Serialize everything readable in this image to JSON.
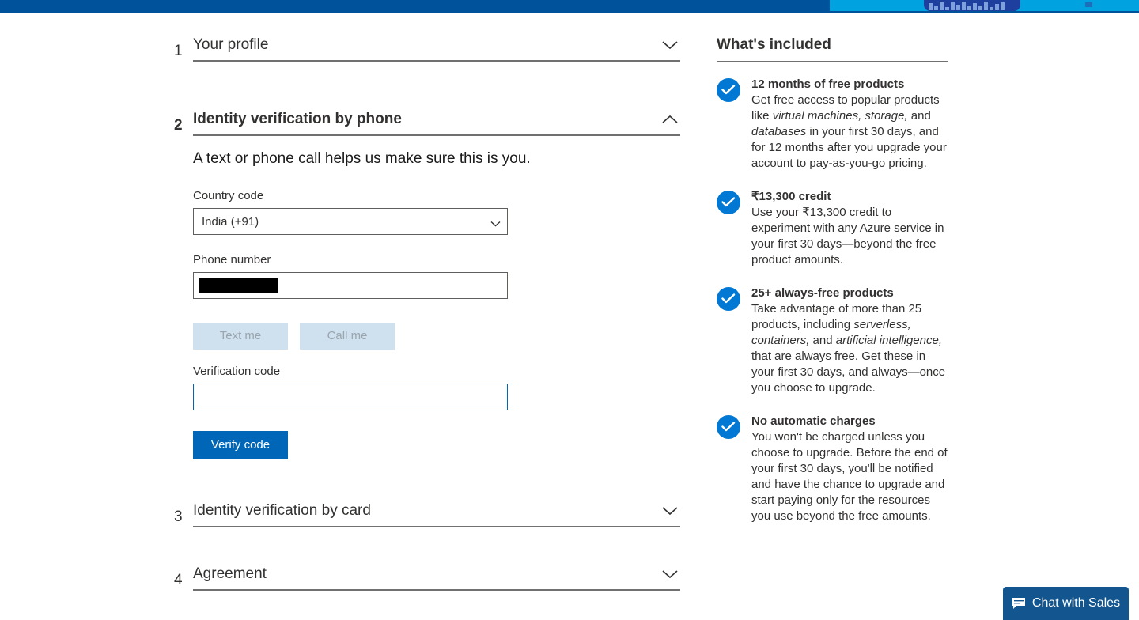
{
  "chrome": {
    "strip_color": "#00529b",
    "strip_accent_color": "#00a2e0"
  },
  "sections": [
    {
      "number": "1",
      "title": "Your profile",
      "expanded": false,
      "chevron": "chevron-down-icon"
    },
    {
      "number": "2",
      "title": "Identity verification by phone",
      "expanded": true,
      "chevron": "chevron-up-icon"
    },
    {
      "number": "3",
      "title": "Identity verification by card",
      "expanded": false,
      "chevron": "chevron-down-icon"
    },
    {
      "number": "4",
      "title": "Agreement",
      "expanded": false,
      "chevron": "chevron-down-icon"
    }
  ],
  "phone_verification": {
    "lede": "A text or phone call helps us make sure this is you.",
    "country_code_label": "Country code",
    "country_code_value": "India (+91)",
    "country_code_options": [
      "India (+91)"
    ],
    "phone_label": "Phone number",
    "phone_value": "",
    "phone_redacted": true,
    "text_me_label": "Text me",
    "call_me_label": "Call me",
    "text_me_disabled": true,
    "call_me_disabled": true,
    "verification_code_label": "Verification code",
    "verification_code_value": "",
    "verify_code_label": "Verify code",
    "primary_button_color": "#0067b8",
    "disabled_button_color": "#cfe0ef"
  },
  "included_panel": {
    "title": "What's included",
    "check_color": "#0078d4",
    "benefits": [
      {
        "title": "12 months of free products",
        "body_parts": [
          {
            "text": "Get free access to popular products like ",
            "italic": false
          },
          {
            "text": "virtual machines, storage,",
            "italic": true
          },
          {
            "text": " and ",
            "italic": false
          },
          {
            "text": "databases",
            "italic": true
          },
          {
            "text": " in your first 30 days, and for 12 months after you upgrade your account to pay-as-you-go pricing.",
            "italic": false
          }
        ]
      },
      {
        "title": "₹13,300 credit",
        "body_parts": [
          {
            "text": "Use your ₹13,300 credit to experiment with any Azure service in your first 30 days—beyond the free product amounts.",
            "italic": false
          }
        ]
      },
      {
        "title": "25+ always-free products",
        "body_parts": [
          {
            "text": "Take advantage of more than 25 products, including ",
            "italic": false
          },
          {
            "text": "serverless, containers,",
            "italic": true
          },
          {
            "text": " and ",
            "italic": false
          },
          {
            "text": "artificial intelligence,",
            "italic": true
          },
          {
            "text": " that are always free. Get these in your first 30 days, and always—once you choose to upgrade.",
            "italic": false
          }
        ]
      },
      {
        "title": "No automatic charges",
        "body_parts": [
          {
            "text": "You won't be charged unless you choose to upgrade. Before the end of your first 30 days, you'll be notified and have the chance to upgrade and start paying only for the resources you use beyond the free amounts.",
            "italic": false
          }
        ]
      }
    ]
  },
  "chat": {
    "label": "Chat with Sales",
    "icon": "chat-bubble-icon",
    "color": "#12558f"
  }
}
